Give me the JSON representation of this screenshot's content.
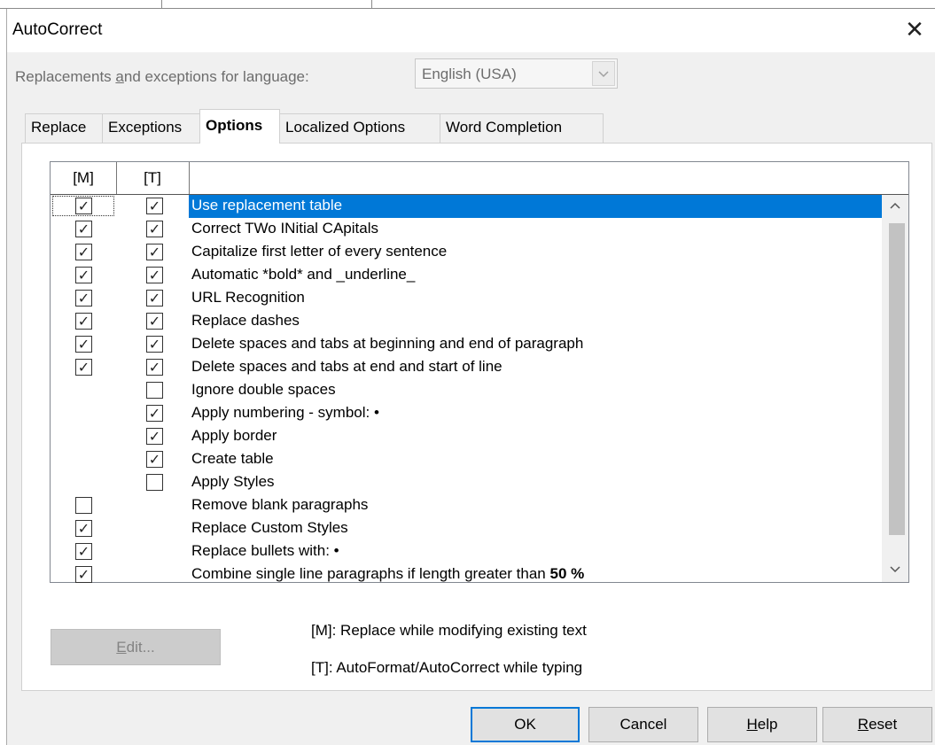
{
  "dialog": {
    "title": "AutoCorrect",
    "close_icon": "close-icon"
  },
  "language": {
    "label_pre": "Replacements ",
    "label_mnemonic": "a",
    "label_post": "nd exceptions for language:",
    "selected": "English (USA)"
  },
  "tabs": [
    {
      "label": "Replace",
      "active": false
    },
    {
      "label": "Exceptions",
      "active": false
    },
    {
      "label": "Options",
      "active": true
    },
    {
      "label": "Localized Options",
      "active": false
    },
    {
      "label": "Word Completion",
      "active": false
    }
  ],
  "list": {
    "header_m": "[M]",
    "header_t": "[T]",
    "rows": [
      {
        "label": "Use replacement table",
        "m": true,
        "t": true,
        "selected": true
      },
      {
        "label": "Correct TWo INitial CApitals",
        "m": true,
        "t": true
      },
      {
        "label": "Capitalize first letter of every sentence",
        "m": true,
        "t": true
      },
      {
        "label": "Automatic *bold* and _underline_",
        "m": true,
        "t": true
      },
      {
        "label": "URL Recognition",
        "m": true,
        "t": true
      },
      {
        "label": "Replace dashes",
        "m": true,
        "t": true
      },
      {
        "label": "Delete spaces and tabs at beginning and end of paragraph",
        "m": true,
        "t": true
      },
      {
        "label": "Delete spaces and tabs at end and start of line",
        "m": true,
        "t": true
      },
      {
        "label": "Ignore double spaces",
        "m": null,
        "t": false
      },
      {
        "label": "Apply numbering - symbol: •",
        "m": null,
        "t": true
      },
      {
        "label": "Apply border",
        "m": null,
        "t": true
      },
      {
        "label": "Create table",
        "m": null,
        "t": true
      },
      {
        "label": "Apply Styles",
        "m": null,
        "t": false
      },
      {
        "label": "Remove blank paragraphs",
        "m": false,
        "t": null
      },
      {
        "label": "Replace Custom Styles",
        "m": true,
        "t": null
      },
      {
        "label": "Replace bullets with: •",
        "m": true,
        "t": null
      },
      {
        "label": "Combine single line paragraphs if length greater than",
        "bold_suffix": "50 %",
        "m": true,
        "t": null
      }
    ],
    "scroll_up_icon": "chevron-up-icon",
    "scroll_down_icon": "chevron-down-icon"
  },
  "edit_button": {
    "mnemonic": "E",
    "rest": "dit..."
  },
  "legend": {
    "m": "[M]: Replace while modifying existing text",
    "t": "[T]: AutoFormat/AutoCorrect while typing"
  },
  "buttons": {
    "ok": "OK",
    "cancel": "Cancel",
    "help_mnemonic": "H",
    "help_rest": "elp",
    "reset_mnemonic": "R",
    "reset_rest": "eset"
  },
  "colors": {
    "selection": "#0078d7",
    "dialog_bg": "#f0f0f0",
    "disabled_text": "#838383"
  }
}
